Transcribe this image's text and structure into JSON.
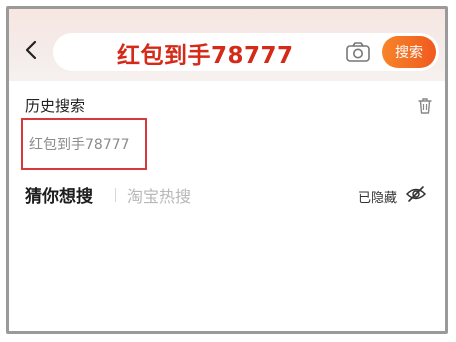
{
  "header": {
    "back_icon": "chevron-left-icon",
    "search_value": "红包到手78777",
    "camera_icon": "camera-icon",
    "search_button_label": "搜索",
    "accent_color": "#f26a22"
  },
  "history": {
    "title": "历史搜索",
    "delete_icon": "trash-icon",
    "items": [
      {
        "label": "红包到手78777"
      }
    ],
    "highlight_color": "#d6393c"
  },
  "suggestions": {
    "guess_title": "猜你想搜",
    "hot_title": "淘宝热搜",
    "hidden_label": "已隐藏",
    "hidden_icon": "eye-off-icon"
  }
}
